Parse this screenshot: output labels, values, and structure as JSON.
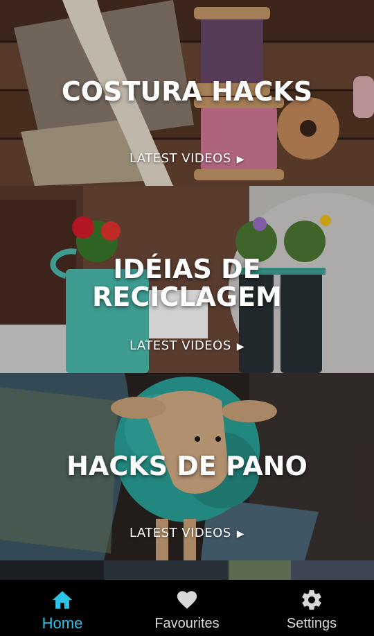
{
  "cards": [
    {
      "title": "COSTURA HACKS",
      "link": "LATEST VIDEOS",
      "arrow": "▶"
    },
    {
      "title": "IDÉIAS DE RECICLAGEM",
      "link": "LATEST VIDEOS",
      "arrow": "▶"
    },
    {
      "title": "HACKS DE PANO",
      "link": "LATEST VIDEOS",
      "arrow": "▶"
    }
  ],
  "nav": {
    "items": [
      {
        "label": "Home",
        "icon": "home-icon",
        "active": true
      },
      {
        "label": "Favourites",
        "icon": "heart-icon",
        "active": false
      },
      {
        "label": "Settings",
        "icon": "gear-icon",
        "active": false
      }
    ]
  },
  "colors": {
    "accent": "#2ec4e8",
    "nav_background": "#000000",
    "nav_inactive": "#d8d8d8"
  }
}
